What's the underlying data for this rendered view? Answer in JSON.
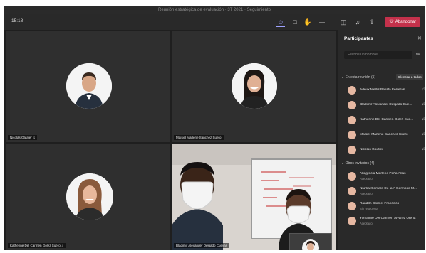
{
  "window": {
    "title": "Reunión estratégica de evaluación · 3T 2021 · Seguimiento"
  },
  "toolbar": {
    "timer": "15:18",
    "icons": [
      "participants-icon",
      "chat-icon",
      "raise-hand-icon",
      "more-icon",
      "camera-icon",
      "microphone-icon",
      "share-icon"
    ],
    "leave_label": "Abandonar",
    "accent": "#9ea2ff",
    "leave_color": "#c4314b"
  },
  "tiles": [
    {
      "name": "Nicolás Gautier"
    },
    {
      "name": "Maisiel Marlene Sánchez Suero"
    },
    {
      "name": "Katherine Del Carmen Gólez Suero"
    },
    {
      "name": "Bladimir Alexander Delgado Cuevas"
    }
  ],
  "panel": {
    "title": "Participantes",
    "search_placeholder": "Escribe un nombre",
    "in_meeting_label": "En esta reunión (5)",
    "mute_all_label": "Silenciar a todos",
    "invited_label": "Otros invitados (4)",
    "in_meeting": [
      {
        "name": "Adeux Merlis Batista Ferreras"
      },
      {
        "name": "Bladimir Alexander Delgado Cue..."
      },
      {
        "name": "Katherine Del Carmen Gólez Sue..."
      },
      {
        "name": "Maisiel Marlene Sánchez Suero"
      },
      {
        "name": "Nicolás Gautier"
      }
    ],
    "invited": [
      {
        "name": "Altagracia Marlene Peña Arias",
        "status": "Aceptado"
      },
      {
        "name": "Niurka Xiomara De la A Germoso M...",
        "status": "Aceptado"
      },
      {
        "name": "Randith Corniel Francisco",
        "status": "Sin respuesta"
      },
      {
        "name": "Yomaime Del Carmen Álvarez Ureña",
        "status": "Aceptado"
      }
    ]
  }
}
